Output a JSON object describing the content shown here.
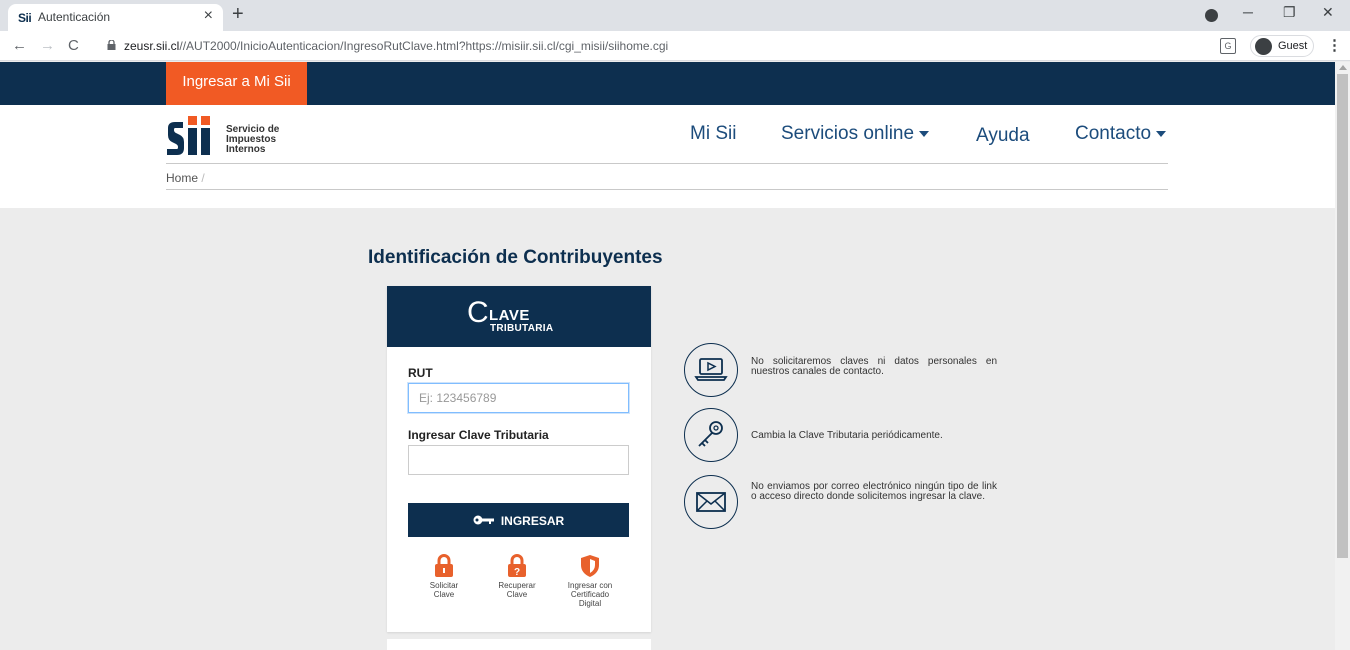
{
  "browser": {
    "tab_title": "Autenticación",
    "favicon_text": "Sii",
    "url_host": "zeusr.sii.cl",
    "url_path": "//AUT2000/InicioAutenticacion/IngresoRutClave.html?https://misiir.sii.cl/cgi_misii/siihome.cgi",
    "guest_label": "Guest"
  },
  "top_band": {
    "ingresar_label": "Ingresar a Mi Sii"
  },
  "header": {
    "logo_lines": [
      "Servicio de",
      "Impuestos",
      "Internos"
    ],
    "nav": {
      "mi_sii": "Mi Sii",
      "servicios": "Servicios online",
      "ayuda": "Ayuda",
      "contacto": "Contacto"
    },
    "breadcrumb_home": "Home",
    "breadcrumb_sep": "/"
  },
  "main": {
    "title": "Identificación de Contribuyentes",
    "brand": {
      "c": "C",
      "lave": "LAVE",
      "tributaria": "TRIBUTARIA"
    },
    "rut_label": "RUT",
    "rut_placeholder": "Ej: 123456789",
    "rut_value": "",
    "clave_label": "Ingresar Clave Tributaria",
    "clave_value": "",
    "submit_label": "INGRESAR",
    "options": [
      {
        "label_1": "Solicitar",
        "label_2": "Clave",
        "icon": "lock-icon"
      },
      {
        "label_1": "Recuperar",
        "label_2": "Clave",
        "icon": "lock-question-icon"
      },
      {
        "label_1": "Ingresar con",
        "label_2": "Certificado Digital",
        "icon": "shield-icon"
      }
    ]
  },
  "tips": [
    {
      "icon": "laptop-icon",
      "text": "No solicitaremos claves ni datos personales en nuestros canales de contacto."
    },
    {
      "icon": "key-icon",
      "text": "Cambia la Clave Tributaria periódicamente."
    },
    {
      "icon": "envelope-icon",
      "text": "No enviamos por correo electrónico ningún tipo de link o acceso directo donde solicitemos ingresar la clave."
    }
  ],
  "colors": {
    "navy": "#0d2f4f",
    "orange": "#f15a24",
    "nav_blue": "#1c4c7c",
    "background": "#ececec"
  }
}
